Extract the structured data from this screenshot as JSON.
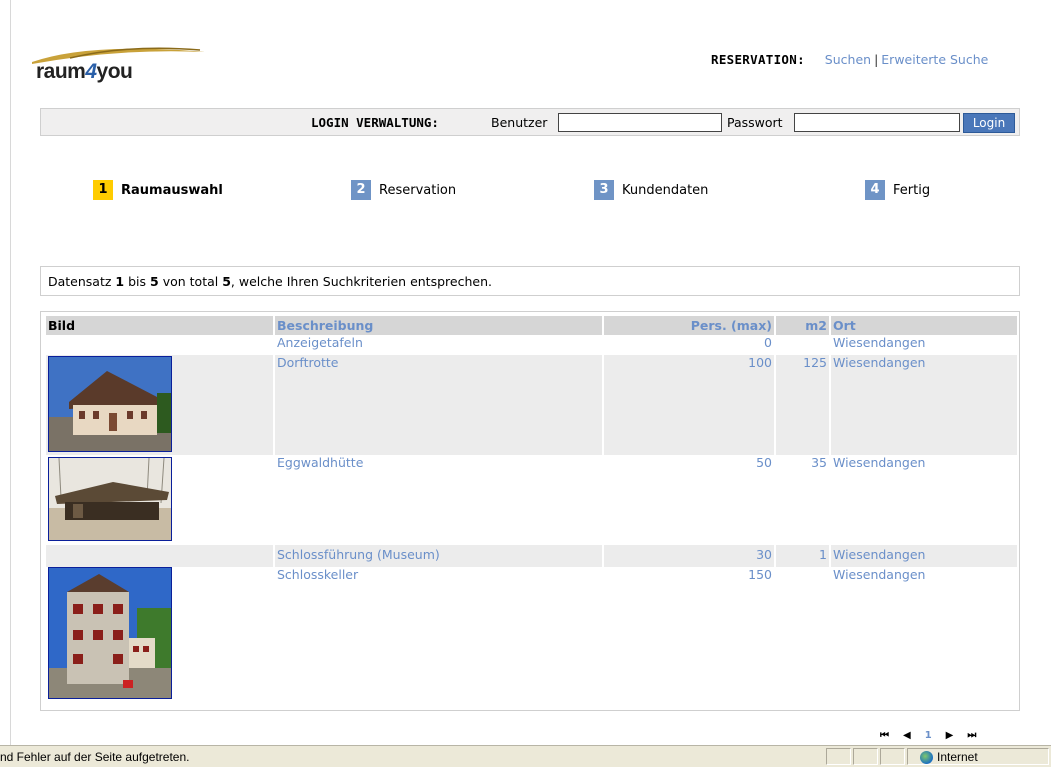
{
  "logo": {
    "part1": "raum",
    "four": "4",
    "part2": "you"
  },
  "header": {
    "reservation_label": "RESERVATION:",
    "search_link": "Suchen",
    "separator": "|",
    "advanced_search_link": "Erweiterte Suche"
  },
  "login": {
    "label": "LOGIN VERWALTUNG:",
    "user_label": "Benutzer",
    "user_value": "",
    "password_label": "Passwort",
    "password_value": "",
    "button": "Login"
  },
  "steps": [
    {
      "num": "1",
      "label": "Raumauswahl",
      "active": true
    },
    {
      "num": "2",
      "label": "Reservation",
      "active": false
    },
    {
      "num": "3",
      "label": "Kundendaten",
      "active": false
    },
    {
      "num": "4",
      "label": "Fertig",
      "active": false
    }
  ],
  "summary": {
    "prefix": "Datensatz",
    "from": "1",
    "mid": "bis",
    "to": "5",
    "of": "von total",
    "total": "5",
    "suffix": ", welche Ihren Suchkriterien entsprechen."
  },
  "table": {
    "columns": {
      "image": "Bild",
      "description": "Beschreibung",
      "persons": "Pers. (max)",
      "area": "m2",
      "place": "Ort"
    },
    "rows": [
      {
        "image": "",
        "description": "Anzeigetafeln",
        "persons": "0",
        "area": "",
        "place": "Wiesendangen"
      },
      {
        "image": "house",
        "description": "Dorftrotte",
        "persons": "100",
        "area": "125",
        "place": "Wiesendangen"
      },
      {
        "image": "hut",
        "description": "Eggwaldhütte",
        "persons": "50",
        "area": "35",
        "place": "Wiesendangen"
      },
      {
        "image": "",
        "description": "Schlossführung (Museum)",
        "persons": "30",
        "area": "1",
        "place": "Wiesendangen"
      },
      {
        "image": "castle",
        "description": "Schlosskeller",
        "persons": "150",
        "area": "",
        "place": "Wiesendangen"
      }
    ]
  },
  "pager": {
    "first": "⏮",
    "prev": "◀",
    "current": "1",
    "next": "▶",
    "last": "⏭"
  },
  "statusbar": {
    "message": "nd Fehler auf der Seite aufgetreten.",
    "zone": "Internet"
  },
  "colors": {
    "link": "#6a8fc9",
    "step_active": "#ffcc00",
    "step_inactive": "#6f94c6",
    "login_button": "#4a77b9"
  }
}
